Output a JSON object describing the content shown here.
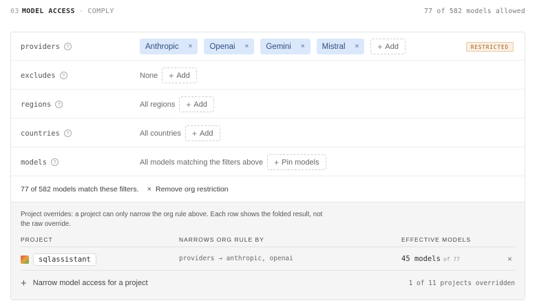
{
  "header": {
    "number": "03",
    "title": "MODEL ACCESS",
    "separator": "·",
    "subtitle": "COMPLY",
    "allowed": "77 of 582 models allowed"
  },
  "rules": {
    "providers": {
      "label": "providers",
      "chips": [
        "Anthropic",
        "Openai",
        "Gemini",
        "Mistral"
      ],
      "add_label": "Add",
      "badge": "RESTRICTED"
    },
    "excludes": {
      "label": "excludes",
      "value": "None",
      "add_label": "Add"
    },
    "regions": {
      "label": "regions",
      "value": "All regions",
      "add_label": "Add"
    },
    "countries": {
      "label": "countries",
      "value": "All countries",
      "add_label": "Add"
    },
    "models": {
      "label": "models",
      "value": "All models matching the filters above",
      "add_label": "Pin models"
    }
  },
  "summary": {
    "text": "77 of 582 models match these filters.",
    "remove_label": "Remove org restriction"
  },
  "overrides": {
    "description": "Project overrides: a project can only narrow the org rule above. Each row shows the folded result, not the raw override.",
    "columns": {
      "project": "PROJECT",
      "narrows": "NARROWS ORG RULE BY",
      "effective": "EFFECTIVE MODELS"
    },
    "rows": [
      {
        "project": "sqlassistant",
        "narrows": "providers → anthropic, openai",
        "effective": "45 models",
        "of": "of 77"
      }
    ],
    "add_label": "Narrow model access for a project",
    "count": "1 of 11 projects overridden"
  },
  "icons": {
    "help": "?",
    "remove": "×",
    "plus": "+"
  },
  "colors": {
    "chip_bg": "#dbe8fb",
    "chip_text": "#2e4e7e",
    "badge_bg": "#fbefe1",
    "badge_text": "#9b5b22",
    "panel_bg": "#f5f5f5"
  }
}
